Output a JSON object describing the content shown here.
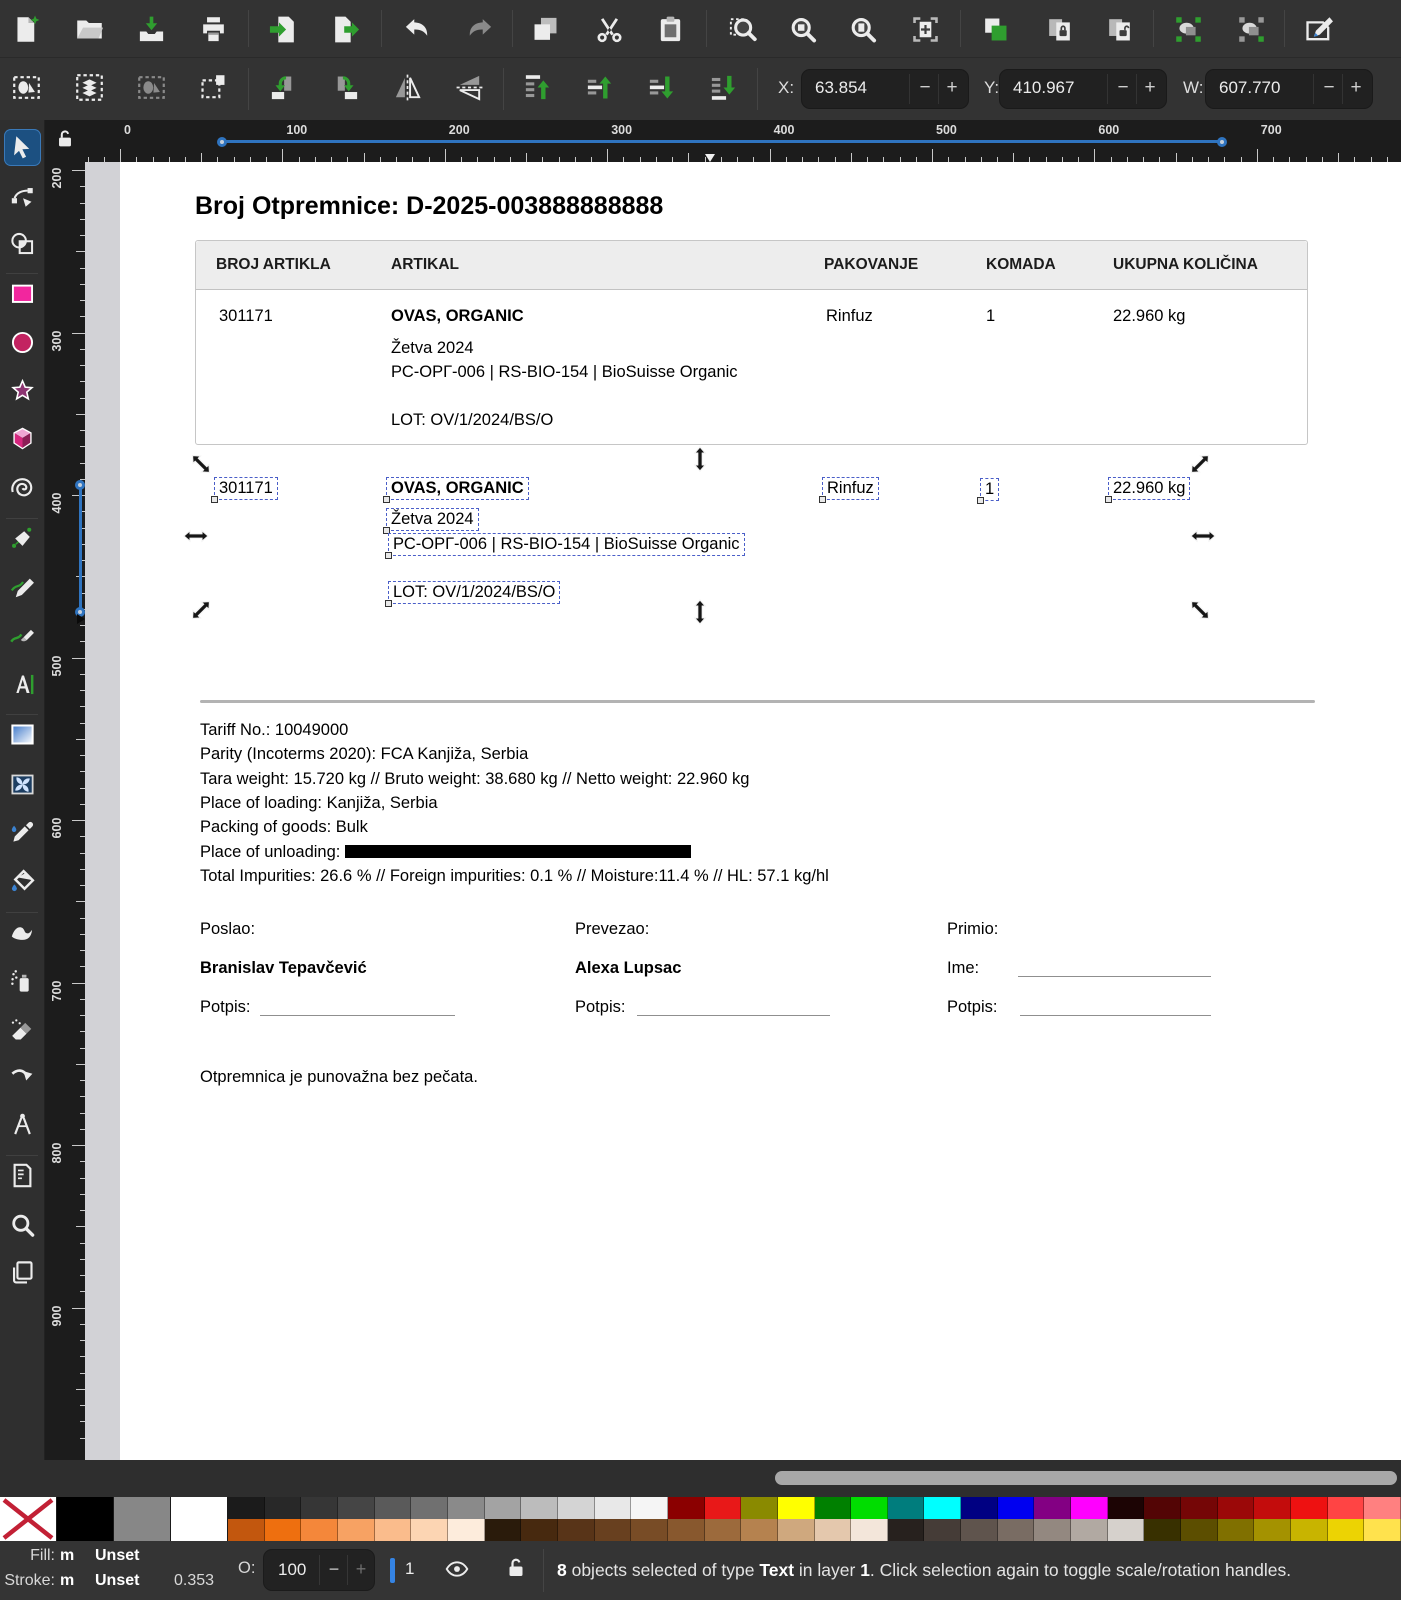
{
  "toolbar_main": {
    "items": [
      "new-document",
      "open-document",
      "save-document",
      "print-document",
      "import-document",
      "export-document",
      "undo",
      "redo",
      "copy",
      "cut",
      "paste",
      "zoom-selection",
      "zoom-drawing",
      "zoom-page",
      "zoom-page-width",
      "duplicate",
      "create-clone",
      "unlink-clone",
      "group-objects",
      "ungroup-objects",
      "fill-stroke-dialog"
    ]
  },
  "toolbar_tool": {
    "items": [
      "select-all",
      "select-all-layers",
      "deselect",
      "toggle-selection-cue",
      "rotate-90-ccw",
      "rotate-90-cw",
      "flip-horizontal",
      "flip-vertical",
      "raise-to-top",
      "raise",
      "lower",
      "lower-to-bottom"
    ],
    "fields": [
      {
        "label": "X:",
        "value": "63.854"
      },
      {
        "label": "Y:",
        "value": "410.967"
      },
      {
        "label": "W:",
        "value": "607.770"
      }
    ],
    "stepper": {
      "minus": "−",
      "plus": "+"
    }
  },
  "toolbox": {
    "active_tool": "selector",
    "tools": [
      "selector",
      "node-editor",
      "shape-builder",
      "rectangle",
      "ellipse",
      "star",
      "box-3d",
      "spiral",
      "pen",
      "pencil",
      "calligraphy",
      "text",
      "gradient",
      "mesh-gradient",
      "dropper",
      "paint-bucket",
      "tweak",
      "spray",
      "eraser",
      "connector",
      "measure",
      "page",
      "zoom",
      "pages"
    ]
  },
  "rulers": {
    "horizontal_labels": [
      "0",
      "100",
      "200",
      "300",
      "400",
      "500",
      "600",
      "700"
    ],
    "vertical_labels": [
      "200",
      "300",
      "400",
      "500",
      "600",
      "700",
      "800",
      "900"
    ]
  },
  "document": {
    "title": "Broj Otpremnice: D-2025-003888888888",
    "table": {
      "headers": [
        "BROJ ARTIKLA",
        "ARTIKAL",
        "PAKOVANJE",
        "KOMADA",
        "UKUPNA KOLIČINA"
      ],
      "row": {
        "broj_artikla": "301171",
        "artikal": "OVAS, ORGANIC",
        "artikal_line2": "Žetva 2024",
        "artikal_line3": "РС-ОРГ-006 | RS-BIO-154 | BioSuisse Organic",
        "artikal_lot": "LOT: OV/1/2024/BS/O",
        "pakovanje": "Rinfuz",
        "komada": "1",
        "ukupna": "22.960 kg"
      }
    },
    "selected_texts": [
      "301171",
      "OVAS, ORGANIC",
      "Rinfuz",
      "1",
      "22.960 kg",
      "Žetva 2024",
      "РС-ОРГ-006 | RS-BIO-154 | BioSuisse Organic",
      "LOT: OV/1/2024/BS/O"
    ],
    "details": [
      "Tariff No.: 10049000",
      "Parity (Incoterms 2020): FCA Kanjiža, Serbia",
      "Tara weight: 15.720 kg // Bruto weight: 38.680 kg // Netto weight: 22.960 kg",
      "Place of loading: Kanjiža, Serbia",
      "Packing of goods: Bulk",
      "Place of unloading:",
      "Total Impurities: 26.6 % // Foreign impurities: 0.1 % // Moisture:11.4 % // HL: 57.1 kg/hl"
    ],
    "signatures": {
      "col1": {
        "role": "Poslao:",
        "name": "Branislav Tepavčević",
        "sign_label": "Potpis:"
      },
      "col2": {
        "role": "Prevezao:",
        "name": "Alexa Lupsac",
        "sign_label": "Potpis:"
      },
      "col3": {
        "role": "Primio:",
        "name_label": "Ime:",
        "sign_label": "Potpis:"
      }
    },
    "footer_note": "Otpremnica je punovažna bez pečata."
  },
  "palette": {
    "big": [
      "none",
      "#000000",
      "#878787",
      "#ffffff"
    ],
    "row1": [
      "#1b1b1b",
      "#282828",
      "#363636",
      "#454545",
      "#5a5a5a",
      "#707070",
      "#8a8a8a",
      "#a3a3a3",
      "#bcbcbc",
      "#d4d4d4",
      "#e8e8e8",
      "#f5f5f5",
      "#8b0000",
      "#e81818",
      "#8a8a00",
      "#ffff00",
      "#008000",
      "#00dd00",
      "#007d7d",
      "#00ffff",
      "#000082",
      "#0000f0",
      "#830083",
      "#ff00ff",
      "#1c0404",
      "#530505",
      "#750606",
      "#9b0808",
      "#c30c0c",
      "#ee1111",
      "#ff4444",
      "#ff8080"
    ],
    "row2": [
      "#c2570e",
      "#ee6f0f",
      "#f4873a",
      "#f7a263",
      "#fabc8c",
      "#fcd5b3",
      "#fdecdc",
      "#2a1b0b",
      "#47290f",
      "#583418",
      "#68401f",
      "#784c26",
      "#88582e",
      "#9c6a3c",
      "#b5824f",
      "#cfa87e",
      "#e4c8ad",
      "#f3e6da",
      "#27211e",
      "#453c37",
      "#5f544d",
      "#796c63",
      "#938880",
      "#b1a9a2",
      "#d6d1cc",
      "#383000",
      "#5c4e00",
      "#807000",
      "#a49200",
      "#c8b400",
      "#ecd303",
      "#ffe24d"
    ]
  },
  "statusbar": {
    "fill_label": "Fill:",
    "fill_flag": "m",
    "fill_value": "Unset",
    "stroke_label": "Stroke:",
    "stroke_flag": "m",
    "stroke_value": "Unset",
    "stroke_width": "0.353",
    "opacity_label": "O:",
    "opacity_value": "100",
    "layer_number": "1",
    "message": {
      "b1": "8",
      "t1": " objects selected of type ",
      "b2": "Text",
      "t2": " in layer ",
      "b3": "1",
      "t3": ". Click selection again to toggle scale/rotation handles."
    }
  },
  "colors": {
    "accent_blue": "#3584e4",
    "selection_dash": "#4a5ec8",
    "inkscape_green": "#2f9e2f",
    "toolbar_bg": "#333333",
    "ruler_bg": "#1c1c1c",
    "canvas_bg": "#d2d2d6"
  }
}
